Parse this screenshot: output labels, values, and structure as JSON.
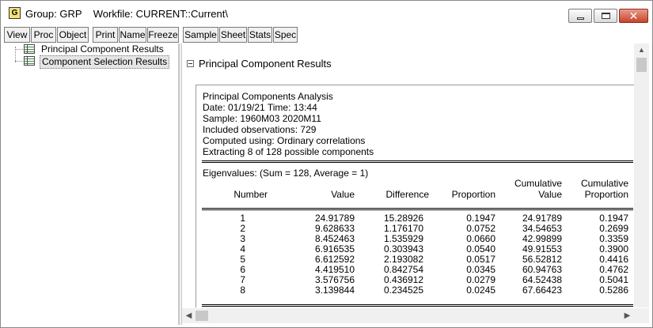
{
  "window": {
    "app_icon_letter": "G",
    "title": "Group: GRP    Workfile: CURRENT::Current\\"
  },
  "toolbar": {
    "buttons": [
      "View",
      "Proc",
      "Object",
      "Print",
      "Name",
      "Freeze",
      "Sample",
      "Sheet",
      "Stats",
      "Spec"
    ]
  },
  "tree": {
    "items": [
      {
        "label": "Principal Component Results",
        "selected": false
      },
      {
        "label": "Component Selection Results",
        "selected": true
      }
    ]
  },
  "output": {
    "section_title": "Principal Component Results",
    "header_lines": [
      "Principal Components Analysis",
      "Date: 01/19/21   Time: 13:44",
      "Sample: 1960M03 2020M11",
      "Included observations: 729",
      "Computed using: Ordinary correlations",
      "Extracting 8 of 128 possible components"
    ],
    "eigen_caption": "Eigenvalues: (Sum = 128, Average = 1)",
    "columns": [
      {
        "line1": "",
        "line2": "Number"
      },
      {
        "line1": "",
        "line2": "Value"
      },
      {
        "line1": "",
        "line2": "Difference"
      },
      {
        "line1": "",
        "line2": "Proportion"
      },
      {
        "line1": "Cumulative",
        "line2": "Value"
      },
      {
        "line1": "Cumulative",
        "line2": "Proportion"
      }
    ],
    "rows": [
      [
        "1",
        "24.91789",
        "15.28926",
        "0.1947",
        "24.91789",
        "0.1947"
      ],
      [
        "2",
        "9.628633",
        "1.176170",
        "0.0752",
        "34.54653",
        "0.2699"
      ],
      [
        "3",
        "8.452463",
        "1.535929",
        "0.0660",
        "42.99899",
        "0.3359"
      ],
      [
        "4",
        "6.916535",
        "0.303943",
        "0.0540",
        "49.91553",
        "0.3900"
      ],
      [
        "5",
        "6.612592",
        "2.193082",
        "0.0517",
        "56.52812",
        "0.4416"
      ],
      [
        "6",
        "4.419510",
        "0.842754",
        "0.0345",
        "60.94763",
        "0.4762"
      ],
      [
        "7",
        "3.576756",
        "0.436912",
        "0.0279",
        "64.52438",
        "0.5041"
      ],
      [
        "8",
        "3.139844",
        "0.234525",
        "0.0245",
        "67.66423",
        "0.5286"
      ]
    ]
  },
  "icons": {
    "app": "group-object-icon",
    "tree_item": "table-icon",
    "collapse": "collapse-minus-icon"
  }
}
